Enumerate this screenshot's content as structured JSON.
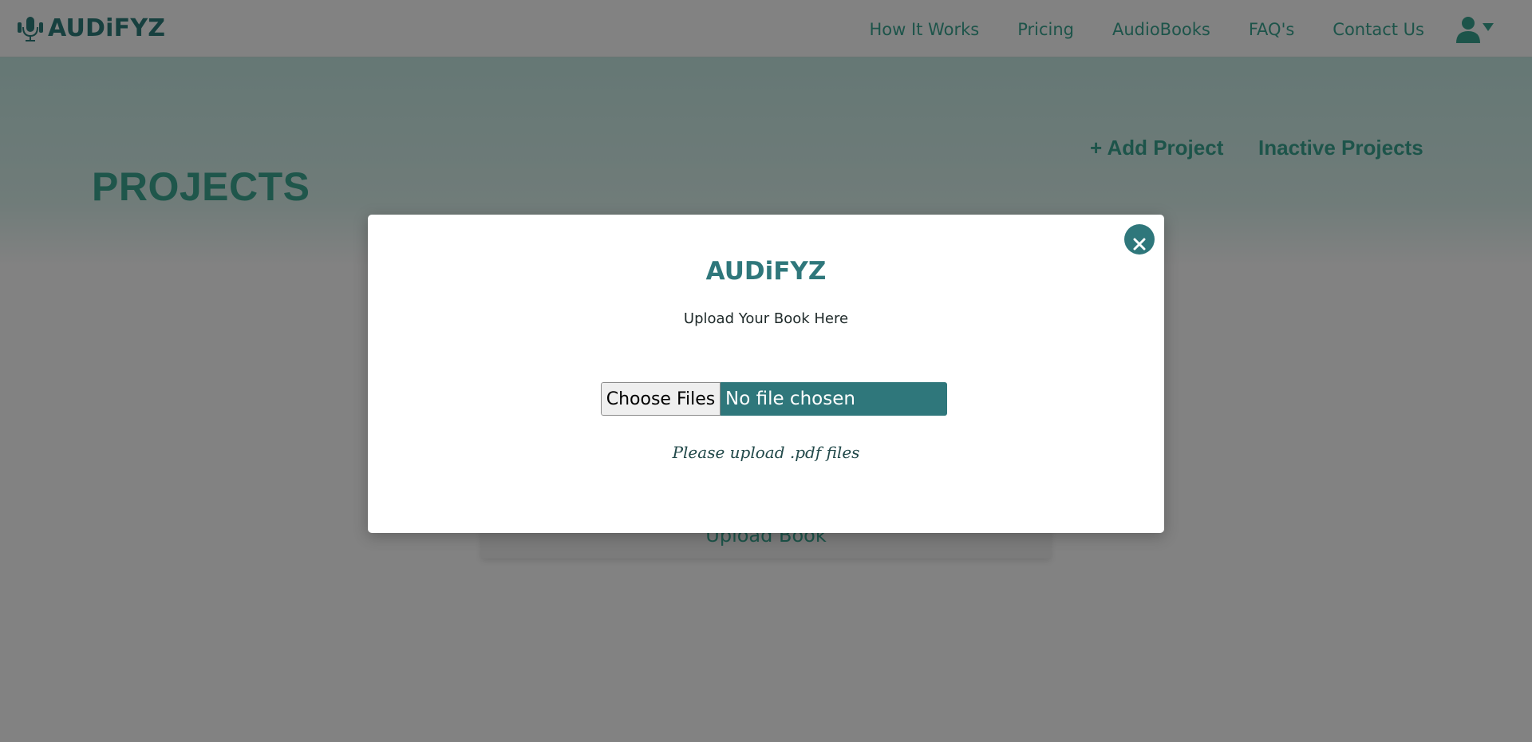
{
  "navbar": {
    "brand": "AUDiFYZ",
    "brand_icon": "headphones-microphone-icon",
    "links": [
      "How It Works",
      "Pricing",
      "AudioBooks",
      "FAQ's",
      "Contact Us"
    ],
    "user_icon": "user-icon",
    "dropdown_icon": "caret-down-icon"
  },
  "page": {
    "title": "PROJECTS",
    "add_project": "+ Add Project",
    "inactive_projects": "Inactive Projects",
    "upload_book": "Upload Book"
  },
  "modal": {
    "title": "AUDiFYZ",
    "subtitle": "Upload Your Book Here",
    "choose_label": "Choose Files",
    "file_status": "No file chosen",
    "hint": "Please upload .pdf files",
    "close_icon": "close-icon"
  },
  "colors": {
    "brand": "#2d7f7c",
    "accent": "#3aa591",
    "modal_accent": "#2f777b",
    "overlay": "rgba(0,0,0,0.49)"
  }
}
